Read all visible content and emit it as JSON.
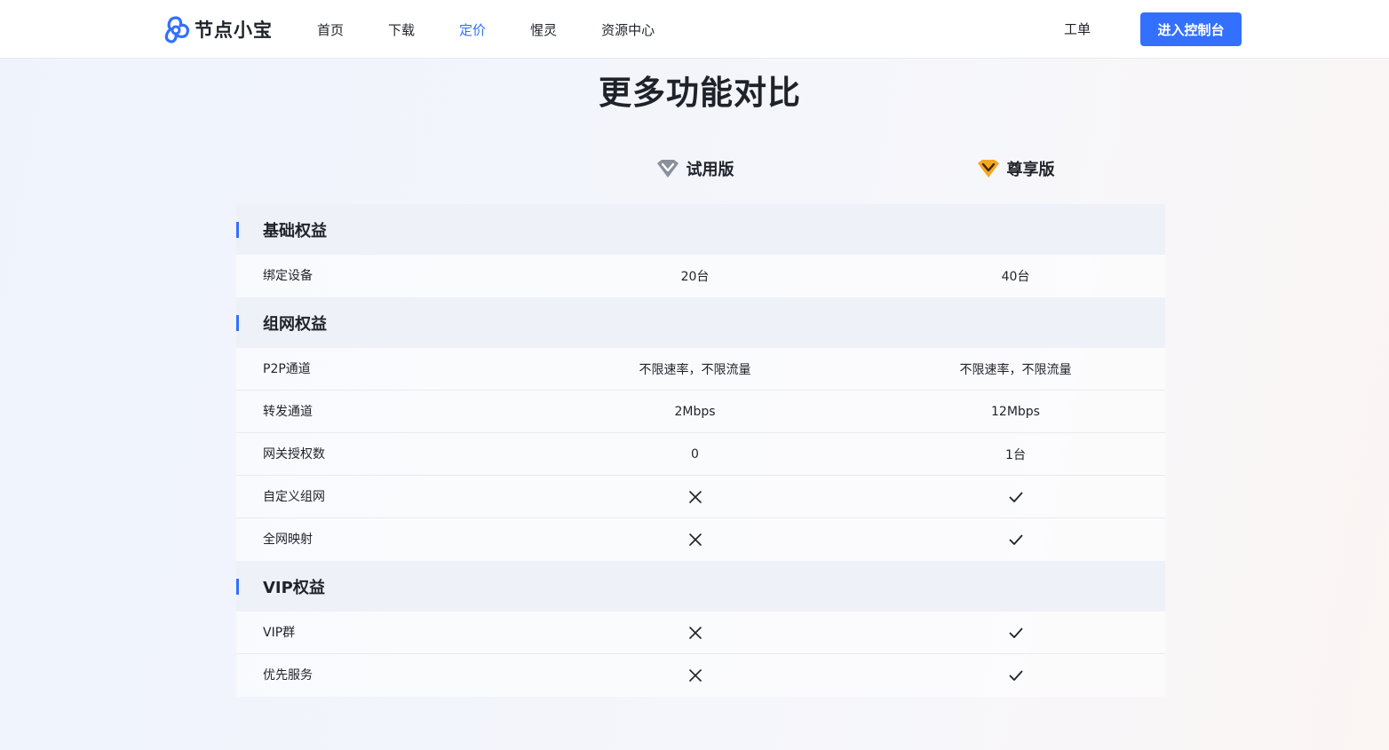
{
  "nav": {
    "brand": "节点小宝",
    "items": [
      "首页",
      "下载",
      "定价",
      "惺灵",
      "资源中心"
    ],
    "active_index": 2,
    "ticket": "工单",
    "console_button": "进入控制台",
    "accent_color": "#3370ff"
  },
  "title": "更多功能对比",
  "plans": [
    {
      "name": "试用版",
      "icon": "diamond-gray-icon",
      "color": "#8a8f99"
    },
    {
      "name": "尊享版",
      "icon": "diamond-gold-icon",
      "color": "#f5a623"
    }
  ],
  "groups": [
    {
      "title": "基础权益",
      "rows": [
        {
          "label": "绑定设备",
          "trial": "20台",
          "premium": "40台"
        }
      ]
    },
    {
      "title": "组网权益",
      "rows": [
        {
          "label": "P2P通道",
          "trial": "不限速率，不限流量",
          "premium": "不限速率，不限流量"
        },
        {
          "label": "转发通道",
          "trial": "2Mbps",
          "premium": "12Mbps"
        },
        {
          "label": "网关授权数",
          "trial": "0",
          "premium": "1台"
        },
        {
          "label": "自定义组网",
          "trial": "cross-icon",
          "premium": "check-icon"
        },
        {
          "label": "全网映射",
          "trial": "cross-icon",
          "premium": "check-icon"
        }
      ]
    },
    {
      "title": "VIP权益",
      "rows": [
        {
          "label": "VIP群",
          "trial": "cross-icon",
          "premium": "check-icon"
        },
        {
          "label": "优先服务",
          "trial": "cross-icon",
          "premium": "check-icon"
        }
      ]
    }
  ]
}
